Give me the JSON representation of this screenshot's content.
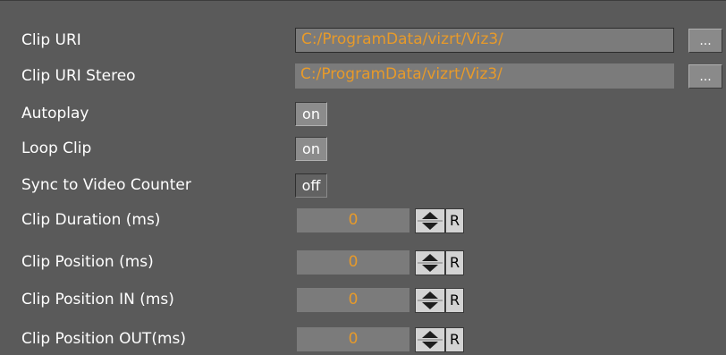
{
  "clip_uri": {
    "label": "Clip URI",
    "value": "C:/ProgramData/vizrt/Viz3/",
    "browse_label": "..."
  },
  "clip_uri_stereo": {
    "label": "Clip URI Stereo",
    "value": "C:/ProgramData/vizrt/Viz3/",
    "browse_label": "..."
  },
  "autoplay": {
    "label": "Autoplay",
    "value": "on"
  },
  "loop_clip": {
    "label": "Loop Clip",
    "value": "on"
  },
  "sync_video_counter": {
    "label": "Sync to Video Counter",
    "value": "off"
  },
  "clip_duration": {
    "label": "Clip Duration (ms)",
    "value": "0",
    "reset_label": "R"
  },
  "clip_position": {
    "label": "Clip Position (ms)",
    "value": "0",
    "reset_label": "R"
  },
  "clip_position_in": {
    "label": "Clip Position IN (ms)",
    "value": "0",
    "reset_label": "R"
  },
  "clip_position_out": {
    "label": "Clip Position OUT(ms)",
    "value": "0",
    "reset_label": "R"
  },
  "colors": {
    "background": "#5a5a5a",
    "field": "#7b7b7b",
    "value_text": "#e79a2a"
  },
  "icons": {
    "spinner": "up-down-spinner-icon"
  }
}
